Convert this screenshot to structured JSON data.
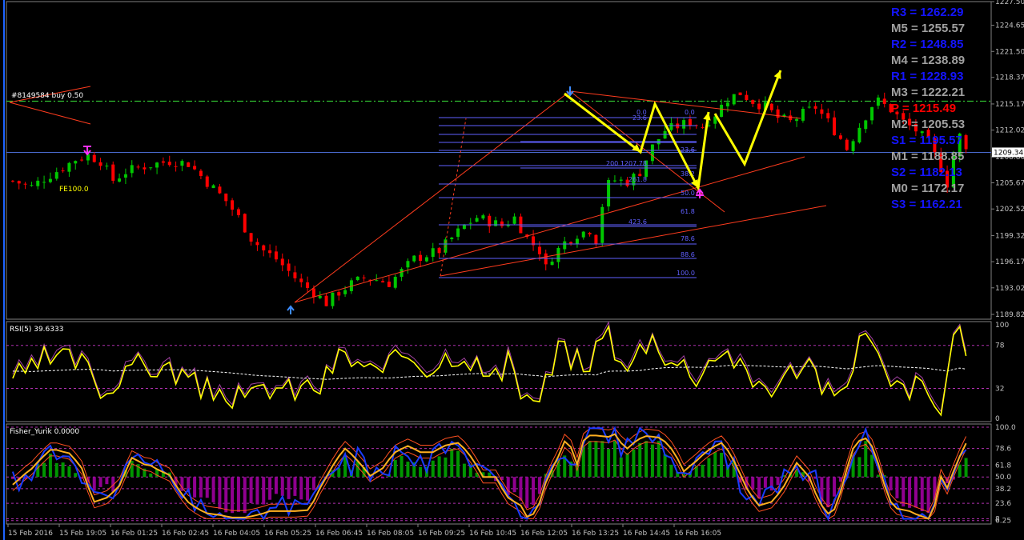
{
  "colors": {
    "background": "#000000",
    "bull": "#00c800",
    "bear": "#ff0000",
    "resistance": "#1414ff",
    "mid": "#a0a0a0",
    "pivot": "#ff0000",
    "axis_text": "#c0c0c0",
    "fib": "#6060ff",
    "yellow": "#ffff00",
    "trend": "#ff3c1e",
    "green_dash": "#30c030"
  },
  "order_label": "#8149584 buy 0.50",
  "fe_label": "FE100.0",
  "price_tag": "1209.34",
  "pivots": [
    {
      "label": "R3 = 1262.29",
      "color": "#1414ff"
    },
    {
      "label": "M5 = 1255.57",
      "color": "#a0a0a0"
    },
    {
      "label": "R2 = 1248.85",
      "color": "#1414ff"
    },
    {
      "label": "M4 = 1238.89",
      "color": "#a0a0a0"
    },
    {
      "label": "R1 = 1228.93",
      "color": "#1414ff"
    },
    {
      "label": "M3 = 1222.21",
      "color": "#a0a0a0"
    },
    {
      "label": "P  = 1215.49",
      "color": "#ff0000"
    },
    {
      "label": "M2 = 1205.53",
      "color": "#a0a0a0"
    },
    {
      "label": "S1 = 1195.57",
      "color": "#1414ff"
    },
    {
      "label": "M1 = 1188.85",
      "color": "#a0a0a0"
    },
    {
      "label": "S2 = 1182.13",
      "color": "#1414ff"
    },
    {
      "label": "M0 = 1172.17",
      "color": "#a0a0a0"
    },
    {
      "label": "S3 = 1162.21",
      "color": "#1414ff"
    }
  ],
  "fib_labels": [
    "0.0",
    "23.6",
    "38.2",
    "50.0",
    "61.8",
    "78.6",
    "88.6",
    "100.0"
  ],
  "fib_ext_labels": [
    "0.0",
    "23.6",
    "38.2",
    "50.0",
    "61.8",
    "200 1207.78",
    "261.8",
    "423.6"
  ],
  "chart_data": [
    {
      "type": "candlestick",
      "title": "",
      "xlabel": "",
      "ylabel": "",
      "ylim": [
        1189.82,
        1227.5
      ],
      "y_ticks": [
        "1227.50",
        "1224.65",
        "1221.50",
        "1218.37",
        "1215.17",
        "1212.02",
        "1208.80",
        "1205.67",
        "1202.52",
        "1199.32",
        "1196.17",
        "1193.02",
        "1189.82"
      ],
      "x_ticks": [
        "15 Feb 2016",
        "15 Feb 19:05",
        "16 Feb 01:25",
        "16 Feb 02:45",
        "16 Feb 04:05",
        "16 Feb 05:25",
        "16 Feb 06:45",
        "16 Feb 08:05",
        "16 Feb 09:25",
        "16 Feb 10:45",
        "16 Feb 12:05",
        "16 Feb 13:25",
        "16 Feb 14:45",
        "16 Feb 16:05"
      ],
      "close_path": [
        [
          0,
          1205.9
        ],
        [
          3,
          1205.2
        ],
        [
          5,
          1206.2
        ],
        [
          8,
          1207.5
        ],
        [
          10,
          1208.5
        ],
        [
          12,
          1209.0
        ],
        [
          14,
          1208.3
        ],
        [
          16,
          1206.0
        ],
        [
          18,
          1207.0
        ],
        [
          20,
          1207.5
        ],
        [
          23,
          1208.0
        ],
        [
          25,
          1208.3
        ],
        [
          28,
          1208.0
        ],
        [
          30,
          1206.5
        ],
        [
          32,
          1205.0
        ],
        [
          34,
          1203.5
        ],
        [
          36,
          1201.5
        ],
        [
          38,
          1199.0
        ],
        [
          40,
          1197.5
        ],
        [
          42,
          1196.5
        ],
        [
          44,
          1195.0
        ],
        [
          46,
          1193.5
        ],
        [
          48,
          1192.5
        ],
        [
          50,
          1191.2
        ],
        [
          52,
          1192.5
        ],
        [
          54,
          1193.5
        ],
        [
          56,
          1194.2
        ],
        [
          58,
          1194.0
        ],
        [
          60,
          1193.6
        ],
        [
          62,
          1195.0
        ],
        [
          64,
          1196.5
        ],
        [
          66,
          1197.0
        ],
        [
          68,
          1197.5
        ],
        [
          70,
          1199.0
        ],
        [
          72,
          1200.5
        ],
        [
          74,
          1201.5
        ],
        [
          76,
          1201.0
        ],
        [
          78,
          1200.5
        ],
        [
          80,
          1201.5
        ],
        [
          82,
          1199.0
        ],
        [
          84,
          1197.5
        ],
        [
          85,
          1195.4
        ],
        [
          86,
          1196.8
        ],
        [
          88,
          1198.5
        ],
        [
          90,
          1199.5
        ],
        [
          92,
          1200.0
        ],
        [
          93,
          1198.8
        ],
        [
          94,
          1203.0
        ],
        [
          95,
          1205.5
        ],
        [
          96,
          1206.0
        ],
        [
          98,
          1205.8
        ],
        [
          100,
          1207.0
        ],
        [
          102,
          1210.0
        ],
        [
          104,
          1212.0
        ],
        [
          106,
          1212.5
        ],
        [
          108,
          1213.0
        ],
        [
          110,
          1212.5
        ],
        [
          112,
          1214.0
        ],
        [
          114,
          1215.8
        ],
        [
          116,
          1216.5
        ],
        [
          118,
          1215.5
        ],
        [
          120,
          1214.8
        ],
        [
          122,
          1213.5
        ],
        [
          124,
          1213.0
        ],
        [
          126,
          1214.0
        ],
        [
          128,
          1214.8
        ],
        [
          130,
          1213.0
        ],
        [
          132,
          1211.0
        ],
        [
          133,
          1209.8
        ],
        [
          135,
          1212.5
        ],
        [
          137,
          1215.0
        ],
        [
          138,
          1215.5
        ],
        [
          140,
          1214.5
        ],
        [
          142,
          1213.0
        ],
        [
          144,
          1212.0
        ],
        [
          146,
          1210.5
        ],
        [
          148,
          1207.5
        ],
        [
          149,
          1205.6
        ],
        [
          150,
          1209.0
        ],
        [
          151,
          1211.3
        ],
        [
          152,
          1209.5
        ]
      ],
      "annotations": [
        "#8149584 buy 0.50",
        "FE100.0"
      ]
    },
    {
      "type": "line",
      "title": "RSI(5) 39.6333",
      "ylim": [
        0,
        100
      ],
      "y_ticks": [
        "100",
        "78",
        "32",
        "0"
      ],
      "series": [
        {
          "name": "RSI(5) 39.6333",
          "color": "#ffff00"
        }
      ],
      "current": 39.6333
    },
    {
      "type": "bar+line",
      "title": "Fisher_Yurik 0.0000",
      "ylim": [
        6.0,
        100.0
      ],
      "y_ticks": [
        "100.0",
        "78.6",
        "61.8",
        "50.0",
        "38.2",
        "23.6",
        "8",
        "6.25"
      ]
    }
  ]
}
